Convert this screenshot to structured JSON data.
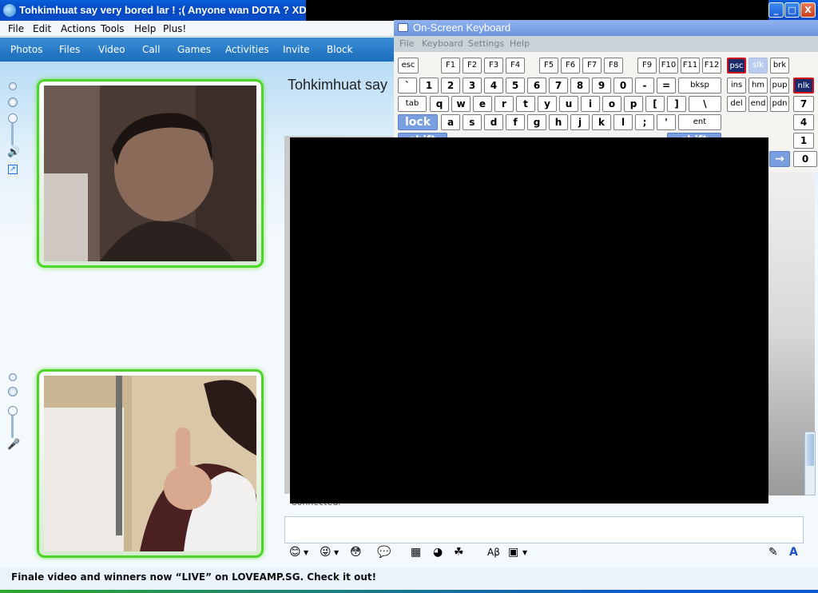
{
  "window": {
    "title": "Tohkimhuat say very bored lar ! ;( Anyone wan DOTA ? XD",
    "controls": {
      "minimize": "_",
      "maximize": "□",
      "close": "X"
    }
  },
  "menubar": [
    "File",
    "Edit",
    "Actions",
    "Tools",
    "Help",
    "Plus!"
  ],
  "toolbar": [
    "Photos",
    "Files",
    "Video",
    "Call",
    "Games",
    "Activities",
    "Invite",
    "Block"
  ],
  "chat": {
    "contact_title": "Tohkimhuat say",
    "status": "Connected.",
    "input_value": ""
  },
  "banner": "Finale video and winners now “LIVE” on LOVEAMP.SG. Check it out!",
  "osk": {
    "title": "On-Screen Keyboard",
    "menu": [
      "File",
      "Keyboard",
      "Settings",
      "Help"
    ],
    "row_fn": [
      "esc",
      "F1",
      "F2",
      "F3",
      "F4",
      "F5",
      "F6",
      "F7",
      "F8",
      "F9",
      "F10",
      "F11",
      "F12",
      "psc",
      "slk",
      "brk"
    ],
    "row_num": [
      "`",
      "1",
      "2",
      "3",
      "4",
      "5",
      "6",
      "7",
      "8",
      "9",
      "0",
      "-",
      "=",
      "bksp",
      "ins",
      "hm",
      "pup",
      "nlk"
    ],
    "row_q": [
      "tab",
      "q",
      "w",
      "e",
      "r",
      "t",
      "y",
      "u",
      "i",
      "o",
      "p",
      "[",
      "]",
      "\\",
      "del",
      "end",
      "pdn",
      "7"
    ],
    "row_a": [
      "lock",
      "a",
      "s",
      "d",
      "f",
      "g",
      "h",
      "j",
      "k",
      "l",
      ";",
      "'",
      "ent",
      "4"
    ],
    "row_z_partial": [
      "shift",
      "shift",
      "1",
      "→",
      "0"
    ]
  }
}
